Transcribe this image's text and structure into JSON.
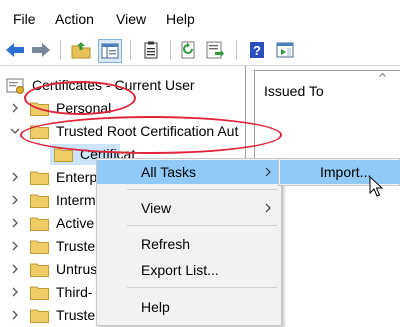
{
  "menubar": {
    "items": [
      "File",
      "Action",
      "View",
      "Help"
    ]
  },
  "toolbar": {
    "buttons": [
      "back-arrow-icon",
      "forward-arrow-icon",
      "up-folder-icon",
      "show-hide-tree-icon",
      "properties-icon",
      "refresh-icon",
      "export-list-icon",
      "help-icon",
      "action-pane-icon"
    ]
  },
  "tree": {
    "root_label": "Certificates - Current User",
    "nodes": [
      {
        "label": "Personal"
      },
      {
        "label": "Trusted Root Certification Aut"
      },
      {
        "label": "Certificat"
      },
      {
        "label": "Enterp"
      },
      {
        "label": "Interm"
      },
      {
        "label": "Active"
      },
      {
        "label": "Truste"
      },
      {
        "label": "Untrus"
      },
      {
        "label": "Third-"
      },
      {
        "label": "Truste"
      }
    ]
  },
  "detail": {
    "column_header": "Issued To"
  },
  "context_menu": {
    "all_tasks": "All Tasks",
    "view": "View",
    "refresh": "Refresh",
    "export_list": "Export List...",
    "help": "Help"
  },
  "submenu": {
    "import": "Import..."
  },
  "colors": {
    "annotation": "#e0243a",
    "menu_highlight": "#91c9f7",
    "selection": "#cce4f7",
    "folder": "#e8c15a"
  }
}
